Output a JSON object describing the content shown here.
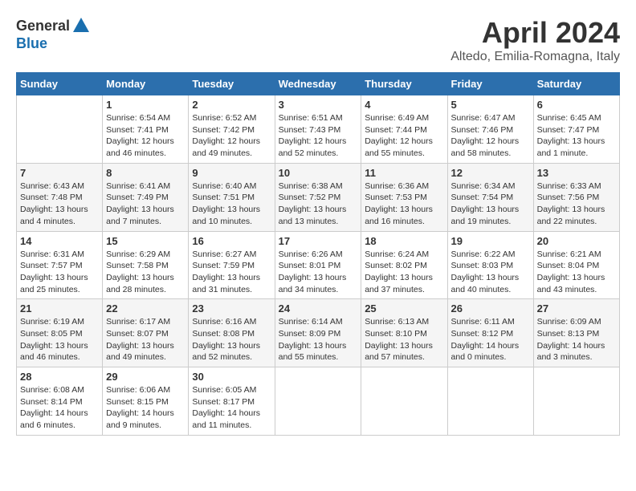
{
  "header": {
    "logo_general": "General",
    "logo_blue": "Blue",
    "title": "April 2024",
    "subtitle": "Altedo, Emilia-Romagna, Italy"
  },
  "weekdays": [
    "Sunday",
    "Monday",
    "Tuesday",
    "Wednesday",
    "Thursday",
    "Friday",
    "Saturday"
  ],
  "weeks": [
    [
      {
        "day": "",
        "info": ""
      },
      {
        "day": "1",
        "info": "Sunrise: 6:54 AM\nSunset: 7:41 PM\nDaylight: 12 hours\nand 46 minutes."
      },
      {
        "day": "2",
        "info": "Sunrise: 6:52 AM\nSunset: 7:42 PM\nDaylight: 12 hours\nand 49 minutes."
      },
      {
        "day": "3",
        "info": "Sunrise: 6:51 AM\nSunset: 7:43 PM\nDaylight: 12 hours\nand 52 minutes."
      },
      {
        "day": "4",
        "info": "Sunrise: 6:49 AM\nSunset: 7:44 PM\nDaylight: 12 hours\nand 55 minutes."
      },
      {
        "day": "5",
        "info": "Sunrise: 6:47 AM\nSunset: 7:46 PM\nDaylight: 12 hours\nand 58 minutes."
      },
      {
        "day": "6",
        "info": "Sunrise: 6:45 AM\nSunset: 7:47 PM\nDaylight: 13 hours\nand 1 minute."
      }
    ],
    [
      {
        "day": "7",
        "info": "Sunrise: 6:43 AM\nSunset: 7:48 PM\nDaylight: 13 hours\nand 4 minutes."
      },
      {
        "day": "8",
        "info": "Sunrise: 6:41 AM\nSunset: 7:49 PM\nDaylight: 13 hours\nand 7 minutes."
      },
      {
        "day": "9",
        "info": "Sunrise: 6:40 AM\nSunset: 7:51 PM\nDaylight: 13 hours\nand 10 minutes."
      },
      {
        "day": "10",
        "info": "Sunrise: 6:38 AM\nSunset: 7:52 PM\nDaylight: 13 hours\nand 13 minutes."
      },
      {
        "day": "11",
        "info": "Sunrise: 6:36 AM\nSunset: 7:53 PM\nDaylight: 13 hours\nand 16 minutes."
      },
      {
        "day": "12",
        "info": "Sunrise: 6:34 AM\nSunset: 7:54 PM\nDaylight: 13 hours\nand 19 minutes."
      },
      {
        "day": "13",
        "info": "Sunrise: 6:33 AM\nSunset: 7:56 PM\nDaylight: 13 hours\nand 22 minutes."
      }
    ],
    [
      {
        "day": "14",
        "info": "Sunrise: 6:31 AM\nSunset: 7:57 PM\nDaylight: 13 hours\nand 25 minutes."
      },
      {
        "day": "15",
        "info": "Sunrise: 6:29 AM\nSunset: 7:58 PM\nDaylight: 13 hours\nand 28 minutes."
      },
      {
        "day": "16",
        "info": "Sunrise: 6:27 AM\nSunset: 7:59 PM\nDaylight: 13 hours\nand 31 minutes."
      },
      {
        "day": "17",
        "info": "Sunrise: 6:26 AM\nSunset: 8:01 PM\nDaylight: 13 hours\nand 34 minutes."
      },
      {
        "day": "18",
        "info": "Sunrise: 6:24 AM\nSunset: 8:02 PM\nDaylight: 13 hours\nand 37 minutes."
      },
      {
        "day": "19",
        "info": "Sunrise: 6:22 AM\nSunset: 8:03 PM\nDaylight: 13 hours\nand 40 minutes."
      },
      {
        "day": "20",
        "info": "Sunrise: 6:21 AM\nSunset: 8:04 PM\nDaylight: 13 hours\nand 43 minutes."
      }
    ],
    [
      {
        "day": "21",
        "info": "Sunrise: 6:19 AM\nSunset: 8:05 PM\nDaylight: 13 hours\nand 46 minutes."
      },
      {
        "day": "22",
        "info": "Sunrise: 6:17 AM\nSunset: 8:07 PM\nDaylight: 13 hours\nand 49 minutes."
      },
      {
        "day": "23",
        "info": "Sunrise: 6:16 AM\nSunset: 8:08 PM\nDaylight: 13 hours\nand 52 minutes."
      },
      {
        "day": "24",
        "info": "Sunrise: 6:14 AM\nSunset: 8:09 PM\nDaylight: 13 hours\nand 55 minutes."
      },
      {
        "day": "25",
        "info": "Sunrise: 6:13 AM\nSunset: 8:10 PM\nDaylight: 13 hours\nand 57 minutes."
      },
      {
        "day": "26",
        "info": "Sunrise: 6:11 AM\nSunset: 8:12 PM\nDaylight: 14 hours\nand 0 minutes."
      },
      {
        "day": "27",
        "info": "Sunrise: 6:09 AM\nSunset: 8:13 PM\nDaylight: 14 hours\nand 3 minutes."
      }
    ],
    [
      {
        "day": "28",
        "info": "Sunrise: 6:08 AM\nSunset: 8:14 PM\nDaylight: 14 hours\nand 6 minutes."
      },
      {
        "day": "29",
        "info": "Sunrise: 6:06 AM\nSunset: 8:15 PM\nDaylight: 14 hours\nand 9 minutes."
      },
      {
        "day": "30",
        "info": "Sunrise: 6:05 AM\nSunset: 8:17 PM\nDaylight: 14 hours\nand 11 minutes."
      },
      {
        "day": "",
        "info": ""
      },
      {
        "day": "",
        "info": ""
      },
      {
        "day": "",
        "info": ""
      },
      {
        "day": "",
        "info": ""
      }
    ]
  ]
}
